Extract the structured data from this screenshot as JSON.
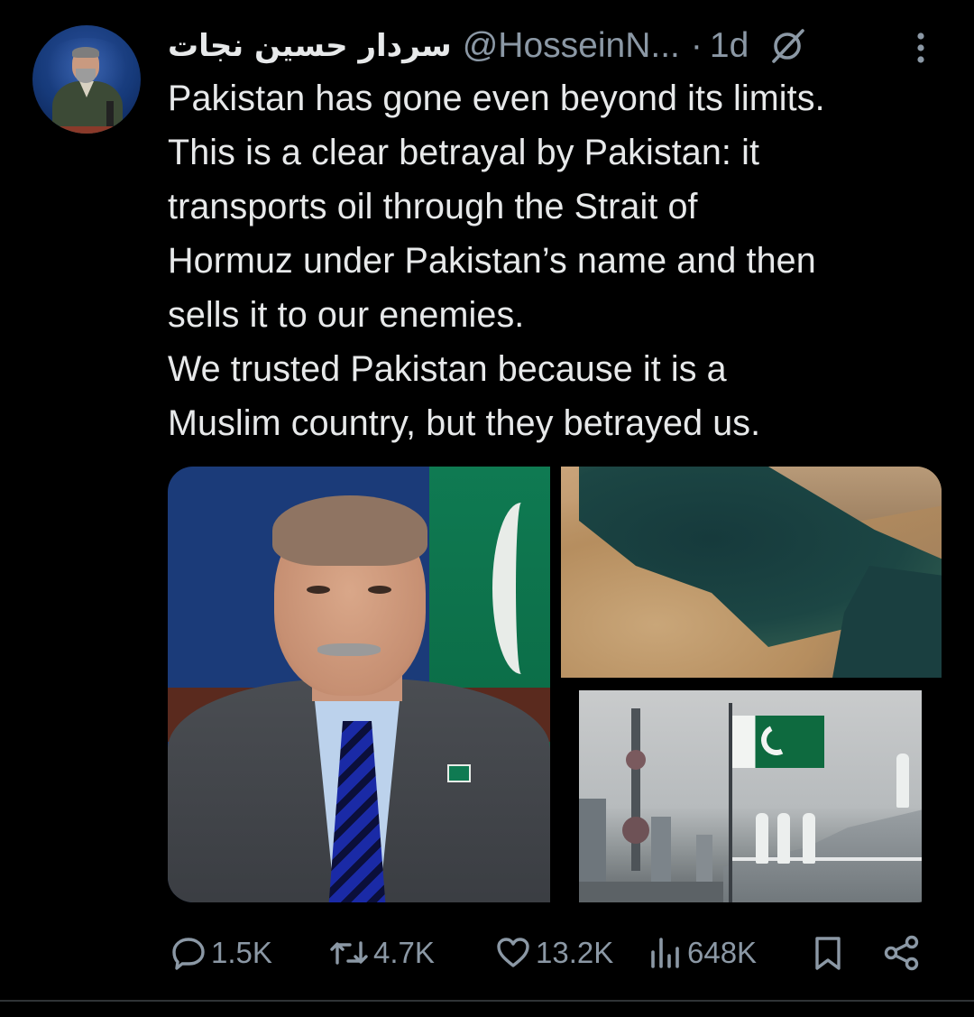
{
  "author": {
    "display_name": "سردار حسین نجات",
    "handle": "@HosseinN...",
    "separator": "·",
    "time": "1d"
  },
  "tweet": {
    "lines": [
      "Pakistan has gone even beyond its limits.",
      "This is a clear betrayal by Pakistan: it",
      "transports oil through the Strait of",
      "Hormuz under Pakistan’s name and then",
      "sells it to our enemies.",
      "We trusted Pakistan because it is a",
      "Muslim country, but they betrayed us."
    ]
  },
  "actions": {
    "replies": "1.5K",
    "reposts": "4.7K",
    "likes": "13.2K",
    "views": "648K"
  },
  "icons": {
    "grok": "grok-icon",
    "more": "more-vertical-icon",
    "reply": "reply-icon",
    "repost": "repost-icon",
    "like": "heart-icon",
    "views": "views-icon",
    "bookmark": "bookmark-icon",
    "share": "share-icon"
  },
  "colors": {
    "background": "#000000",
    "text": "#e7e9ea",
    "muted": "#8b98a5",
    "divider": "#2f3336"
  }
}
